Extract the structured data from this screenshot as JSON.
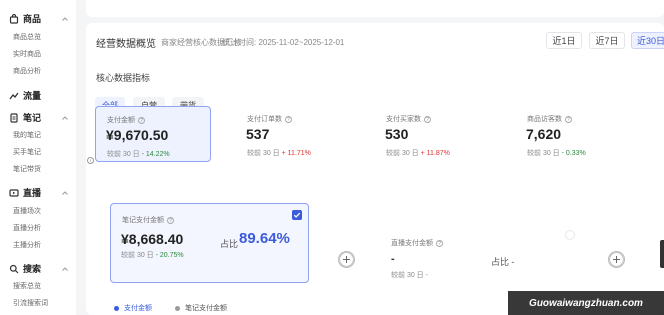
{
  "sidebar": {
    "sections": [
      {
        "title": "商品",
        "icon": "bag-icon",
        "items": [
          "商品总览",
          "实时商品",
          "商品分析"
        ]
      },
      {
        "title": "流量",
        "icon": "flow-icon",
        "items": []
      },
      {
        "title": "笔记",
        "icon": "note-icon",
        "items": [
          "我的笔记",
          "买手笔记",
          "笔记带货"
        ]
      },
      {
        "title": "直播",
        "icon": "live-icon",
        "items": [
          "直播场次",
          "直播分析",
          "主播分析"
        ]
      },
      {
        "title": "搜索",
        "icon": "search-icon",
        "items": [
          "搜索总览",
          "引流搜索词"
        ]
      }
    ]
  },
  "header": {
    "title": "经营数据概览",
    "subtitle": "商家经营核心数据汇总",
    "range": "统计时间: 2025-11-02~2025-12-01",
    "ranges": [
      "近1日",
      "近7日",
      "近30日"
    ],
    "active_range": "近30日"
  },
  "section_title": "核心数据指标",
  "tabs": [
    "全部",
    "自营",
    "带货"
  ],
  "metrics": [
    {
      "label": "支付金额",
      "value": "¥9,670.50",
      "compare_prefix": "较前 30 日",
      "change": "- 14.22%",
      "trend": "down",
      "selected": true
    },
    {
      "label": "支付订单数",
      "value": "537",
      "compare_prefix": "较前 30 日",
      "change": "+ 11.71%",
      "trend": "up"
    },
    {
      "label": "支付买家数",
      "value": "530",
      "compare_prefix": "较前 30 日",
      "change": "+ 11.87%",
      "trend": "up"
    },
    {
      "label": "商品访客数",
      "value": "7,620",
      "compare_prefix": "较前 30 日",
      "change": "- 0.33%",
      "trend": "down"
    }
  ],
  "breakdown": [
    {
      "label": "笔记支付金额",
      "value": "¥8,668.40",
      "compare_prefix": "较前 30 日",
      "change": "- 20.75%",
      "share_label": "占比",
      "share": "89.64%"
    },
    {
      "label": "直播支付金额",
      "value": "-",
      "compare_prefix": "较前 30 日",
      "change": "-",
      "share_label": "占比",
      "share": "-"
    }
  ],
  "legend": [
    "支付金额",
    "笔记支付金额"
  ],
  "colors": {
    "accent": "#3b5bdb",
    "up": "#e03131",
    "down": "#2b8a3e"
  },
  "watermark": "Guowaiwangzhuan.com"
}
